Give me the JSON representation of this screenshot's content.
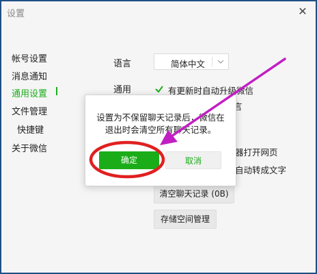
{
  "window": {
    "title": "设置",
    "close_icon": "close-icon"
  },
  "sidebar": {
    "items": [
      {
        "label": "帐号设置"
      },
      {
        "label": "消息通知"
      },
      {
        "label": "通用设置",
        "active": true
      },
      {
        "label": "文件管理"
      },
      {
        "label": "快捷键"
      },
      {
        "label": "关于微信"
      }
    ]
  },
  "settings": {
    "language_label": "语言",
    "language_value": "简体中文",
    "general_label": "通用",
    "auto_update": {
      "checked": true,
      "label": "有更新时自动升级微信"
    },
    "partial_1": "言",
    "partial_2": "器打开网页",
    "partial_3": "自动转成文字",
    "clear_history_button": "清空聊天记录 (0B)",
    "storage_button": "存储空间管理"
  },
  "dialog": {
    "message_line1": "设置为不保留聊天记录后，微信在",
    "message_line2": "退出时会清空所有聊天记录。",
    "ok_label": "确定",
    "cancel_label": "取消"
  },
  "colors": {
    "accent": "#1aad19",
    "annotation": "#e02020",
    "arrow": "#c11fc4",
    "frame_border": "#1f4f86"
  }
}
